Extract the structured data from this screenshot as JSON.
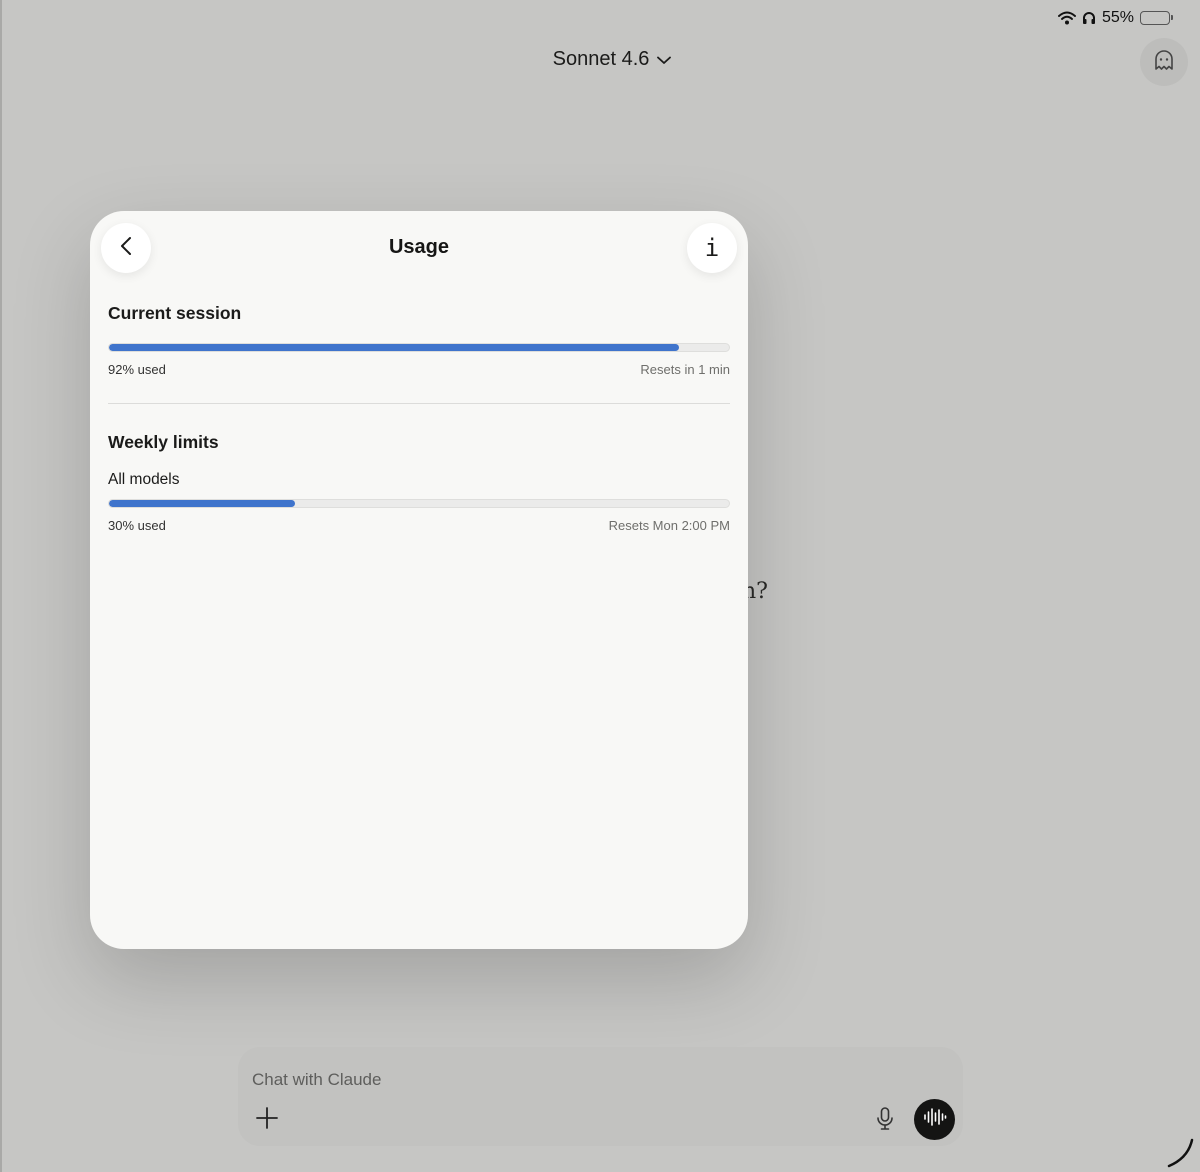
{
  "status_bar": {
    "battery_percent": "55%",
    "battery_level": 0.55,
    "icons": [
      "wifi-icon",
      "headphones-icon",
      "battery-icon"
    ]
  },
  "header": {
    "model_name": "Sonnet 4.6",
    "icons": [
      "chevron-down-icon",
      "ghost-icon"
    ]
  },
  "background": {
    "partial_text": "n?"
  },
  "usage_modal": {
    "title": "Usage",
    "icons": [
      "chevron-left-icon",
      "info-icon"
    ],
    "current_session": {
      "title": "Current session",
      "used_label": "92% used",
      "used_fraction": 0.92,
      "reset_label": "Resets in 1 min"
    },
    "weekly_limits": {
      "title": "Weekly limits",
      "all_models": {
        "label": "All models",
        "used_label": "30% used",
        "used_fraction": 0.3,
        "reset_label": "Resets Mon 2:00 PM"
      }
    }
  },
  "chat_input": {
    "placeholder": "Chat with Claude",
    "icons": [
      "plus-icon",
      "microphone-icon",
      "voice-waveform-icon"
    ]
  },
  "colors": {
    "progress_fill": "#3f74cc",
    "backdrop": "#c6c6c4",
    "modal_background": "#f8f8f6"
  }
}
